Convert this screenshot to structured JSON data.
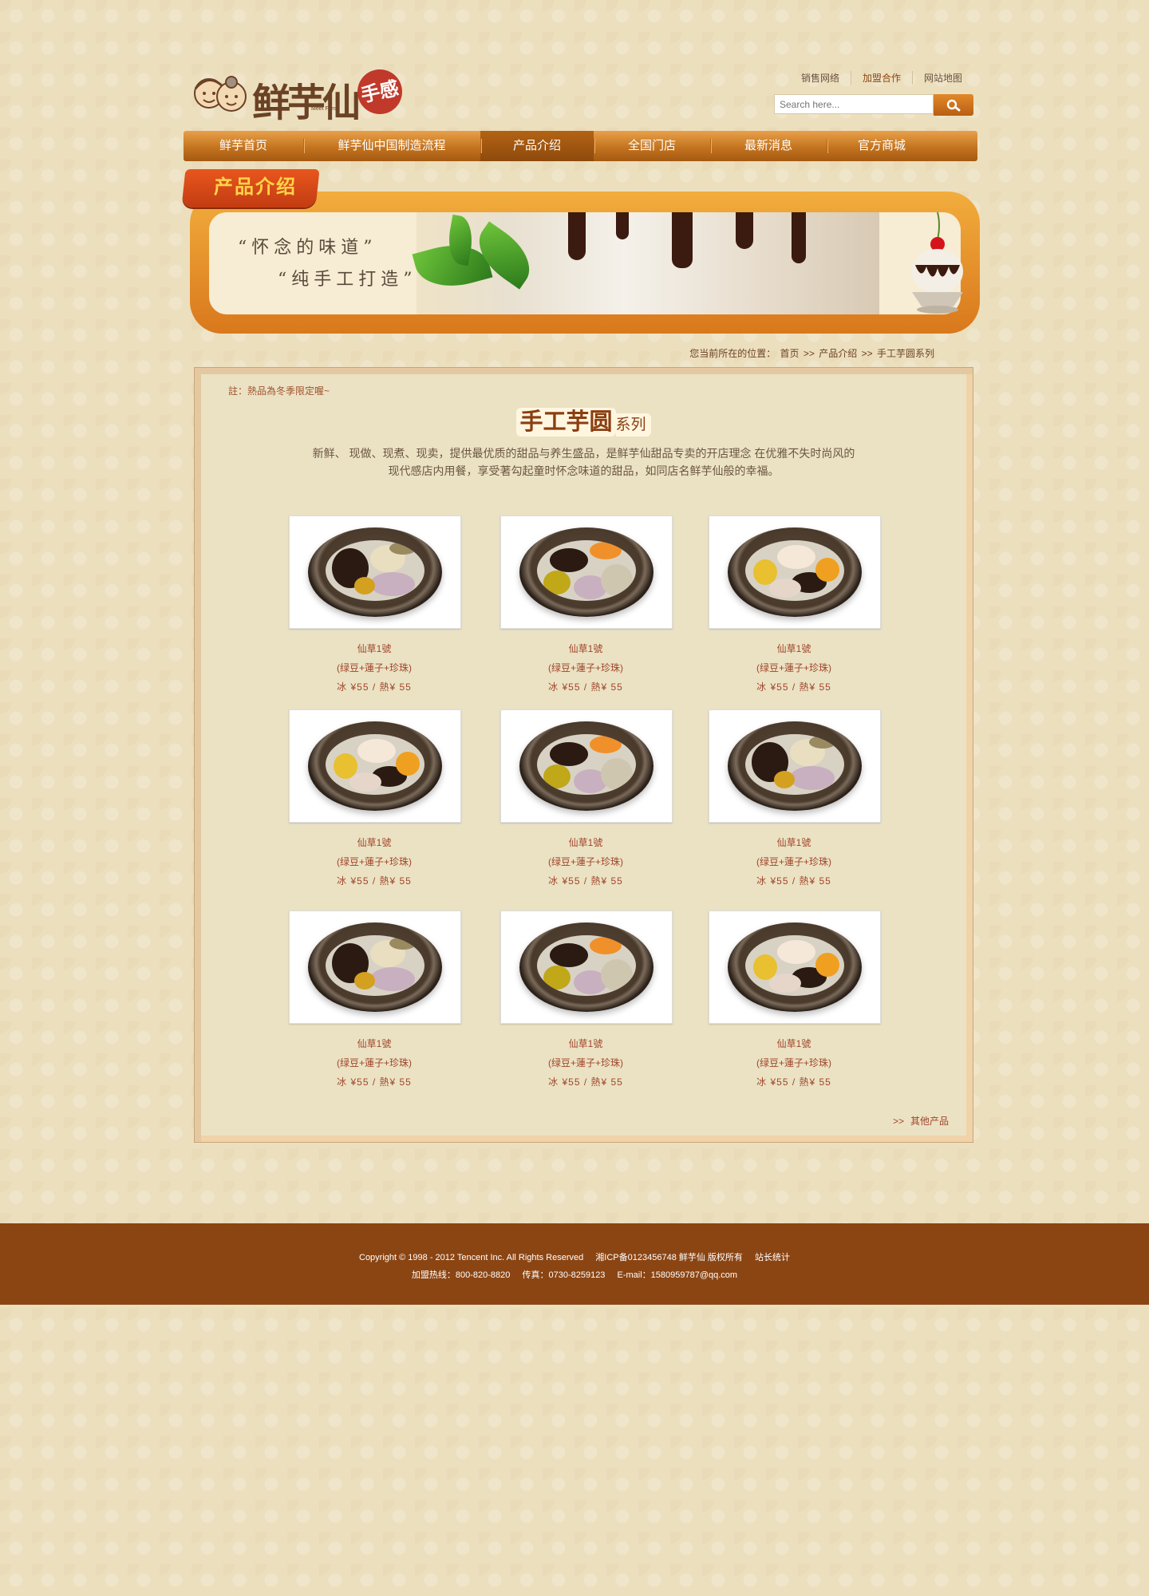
{
  "header": {
    "logo_text": "鲜芋仙",
    "logo_sub": "Meet Fresh",
    "logo_stamp": "手感",
    "top_links": [
      "销售网络",
      "加盟合作",
      "网站地图"
    ],
    "search_placeholder": "Search here..."
  },
  "nav": {
    "items": [
      "鲜芋首页",
      "鲜芋仙中国制造流程",
      "产品介绍",
      "全国门店",
      "最新消息",
      "官方商城"
    ],
    "current_index": 2
  },
  "banner": {
    "ribbon": "产品介绍",
    "slogan_1": "“怀念的味道”",
    "slogan_2": "“纯手工打造”"
  },
  "breadcrumb": {
    "prefix": "您当前所在的位置：",
    "items": [
      "首页",
      ">>",
      "产品介绍",
      ">>",
      "手工芋圆系列"
    ]
  },
  "content": {
    "note": "註：熱品為冬季限定喔~",
    "title_big": "手工芋圆",
    "title_small": "系列",
    "desc_line1": "新鲜、 现做、现煮、现卖，提供最优质的甜品与养生盛品，是鲜芋仙甜品专卖的开店理念 在优雅不失时尚风的",
    "desc_line2": "现代感店内用餐，享受著勾起童时怀念味道的甜品，如同店名鲜芋仙般的幸福。",
    "products": [
      {
        "name": "仙草1號",
        "ingredients": "(绿豆+蓮子+珍珠)",
        "price": "冰 ¥55 / 熱¥ 55",
        "variant": "a"
      },
      {
        "name": "仙草1號",
        "ingredients": "(绿豆+蓮子+珍珠)",
        "price": "冰 ¥55 / 熱¥ 55",
        "variant": "b"
      },
      {
        "name": "仙草1號",
        "ingredients": "(绿豆+蓮子+珍珠)",
        "price": "冰 ¥55 / 熱¥ 55",
        "variant": "c"
      },
      {
        "name": "仙草1號",
        "ingredients": "(绿豆+蓮子+珍珠)",
        "price": "冰 ¥55 / 熱¥ 55",
        "variant": "c"
      },
      {
        "name": "仙草1號",
        "ingredients": "(绿豆+蓮子+珍珠)",
        "price": "冰 ¥55 / 熱¥ 55",
        "variant": "b"
      },
      {
        "name": "仙草1號",
        "ingredients": "(绿豆+蓮子+珍珠)",
        "price": "冰 ¥55 / 熱¥ 55",
        "variant": "a"
      },
      {
        "name": "仙草1號",
        "ingredients": "(绿豆+蓮子+珍珠)",
        "price": "冰 ¥55 / 熱¥ 55",
        "variant": "a"
      },
      {
        "name": "仙草1號",
        "ingredients": "(绿豆+蓮子+珍珠)",
        "price": "冰 ¥55 / 熱¥ 55",
        "variant": "b"
      },
      {
        "name": "仙草1號",
        "ingredients": "(绿豆+蓮子+珍珠)",
        "price": "冰 ¥55 / 熱¥ 55",
        "variant": "c"
      }
    ],
    "more_arrow": ">>",
    "more_label": "其他产品"
  },
  "footer": {
    "copyright": "Copyright © 1998 - 2012 Tencent Inc. All Rights Reserved",
    "icp": "湘ICP备0123456748 鲜芋仙 版权所有",
    "stats": "站长统计",
    "hotline": "加盟热线：800-820-8820",
    "fax": "传真：0730-8259123",
    "email": "E-mail：1580959787@qq.com"
  },
  "colors": {
    "brand_brown": "#8b4513",
    "nav_orange": "#c4741f",
    "page_bg": "#ecdfbe",
    "text_red": "#a0452a"
  },
  "icons": {
    "search": "search-icon",
    "logo_faces": "grandparents-logo-icon"
  }
}
